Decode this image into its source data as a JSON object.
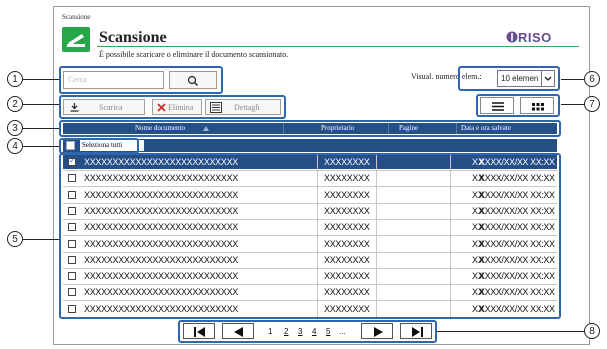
{
  "breadcrumb": "Scansione",
  "header": {
    "title": "Scansione",
    "subtitle": "È possibile scaricare o eliminare il documento scansionato.",
    "brand": "RISO"
  },
  "search": {
    "placeholder": "Cerca"
  },
  "visual": {
    "label": "Visual. numero elem.:",
    "value": "10 elemen"
  },
  "toolbar": {
    "download": "Scarica",
    "delete": "Elimina",
    "details": "Dettagli"
  },
  "table": {
    "headers": [
      "Nome documento",
      "Proprietario",
      "Pagine",
      "Data e ora salvate"
    ],
    "select_all": "Seleziona tutti",
    "rows": [
      {
        "doc": "XXXXXXXXXXXXXXXXXXXXXXXXXXX",
        "owner": "XXXXXXXX",
        "pages": "XX",
        "date": "XXXX/XX/XX XX:XX",
        "selected": true
      },
      {
        "doc": "XXXXXXXXXXXXXXXXXXXXXXXXXXX",
        "owner": "XXXXXXXX",
        "pages": "XX",
        "date": "XXXX/XX/XX XX:XX",
        "selected": false
      },
      {
        "doc": "XXXXXXXXXXXXXXXXXXXXXXXXXXX",
        "owner": "XXXXXXXX",
        "pages": "XX",
        "date": "XXXX/XX/XX XX:XX",
        "selected": false
      },
      {
        "doc": "XXXXXXXXXXXXXXXXXXXXXXXXXXX",
        "owner": "XXXXXXXX",
        "pages": "XX",
        "date": "XXXX/XX/XX XX:XX",
        "selected": false
      },
      {
        "doc": "XXXXXXXXXXXXXXXXXXXXXXXXXXX",
        "owner": "XXXXXXXX",
        "pages": "XX",
        "date": "XXXX/XX/XX XX:XX",
        "selected": false
      },
      {
        "doc": "XXXXXXXXXXXXXXXXXXXXXXXXXXX",
        "owner": "XXXXXXXX",
        "pages": "XX",
        "date": "XXXX/XX/XX XX:XX",
        "selected": false
      },
      {
        "doc": "XXXXXXXXXXXXXXXXXXXXXXXXXXX",
        "owner": "XXXXXXXX",
        "pages": "XX",
        "date": "XXXX/XX/XX XX:XX",
        "selected": false
      },
      {
        "doc": "XXXXXXXXXXXXXXXXXXXXXXXXXXX",
        "owner": "XXXXXXXX",
        "pages": "XX",
        "date": "XXXX/XX/XX XX:XX",
        "selected": false
      },
      {
        "doc": "XXXXXXXXXXXXXXXXXXXXXXXXXXX",
        "owner": "XXXXXXXX",
        "pages": "XX",
        "date": "XXXX/XX/XX XX:XX",
        "selected": false
      },
      {
        "doc": "XXXXXXXXXXXXXXXXXXXXXXXXXXX",
        "owner": "XXXXXXXX",
        "pages": "XX",
        "date": "XXXX/XX/XX XX:XX",
        "selected": false
      }
    ]
  },
  "pager": {
    "pages": [
      "1",
      "2",
      "3",
      "4",
      "5"
    ],
    "more": "..."
  },
  "callouts": [
    "1",
    "2",
    "3",
    "4",
    "5",
    "6",
    "7",
    "8"
  ]
}
